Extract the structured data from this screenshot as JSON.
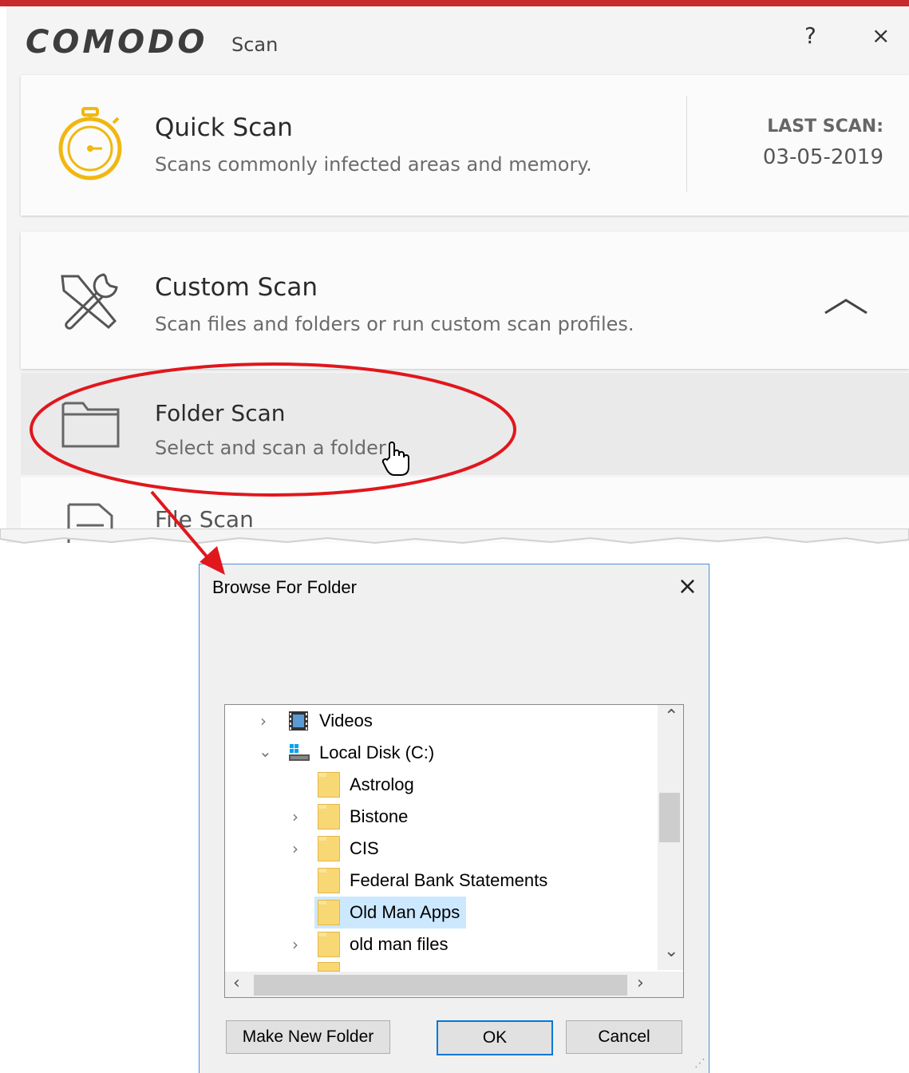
{
  "app": {
    "brand": "COMODO",
    "subtitle": "Scan",
    "help": "?",
    "close": "×"
  },
  "quick_scan": {
    "title": "Quick Scan",
    "description": "Scans commonly infected areas and memory.",
    "last_scan_label": "LAST SCAN:",
    "last_scan_date": "03-05-2019"
  },
  "custom_scan": {
    "title": "Custom Scan",
    "description": "Scan files and folders or run custom scan profiles.",
    "options": [
      {
        "title": "Folder Scan",
        "description": "Select and scan a folder"
      },
      {
        "title": "File Scan"
      }
    ]
  },
  "annotation": {
    "color": "#e0171d"
  },
  "dialog": {
    "title": "Browse For Folder",
    "close": "×",
    "tree": [
      {
        "label": "Videos",
        "chevron": "›",
        "icon": "videos-icon"
      },
      {
        "label": "Local Disk (C:)",
        "chevron": "⌄",
        "icon": "drive-icon"
      },
      {
        "label": "Astrolog",
        "chevron": "",
        "icon": "folder-icon"
      },
      {
        "label": "Bistone",
        "chevron": "›",
        "icon": "folder-icon"
      },
      {
        "label": "CIS",
        "chevron": "›",
        "icon": "folder-icon"
      },
      {
        "label": "Federal Bank Statements",
        "chevron": "",
        "icon": "folder-icon"
      },
      {
        "label": "Old Man Apps",
        "chevron": "",
        "icon": "folder-icon",
        "selected": true
      },
      {
        "label": "old man files",
        "chevron": "›",
        "icon": "folder-icon"
      }
    ],
    "buttons": {
      "new_folder": "Make New Folder",
      "ok": "OK",
      "cancel": "Cancel"
    }
  }
}
